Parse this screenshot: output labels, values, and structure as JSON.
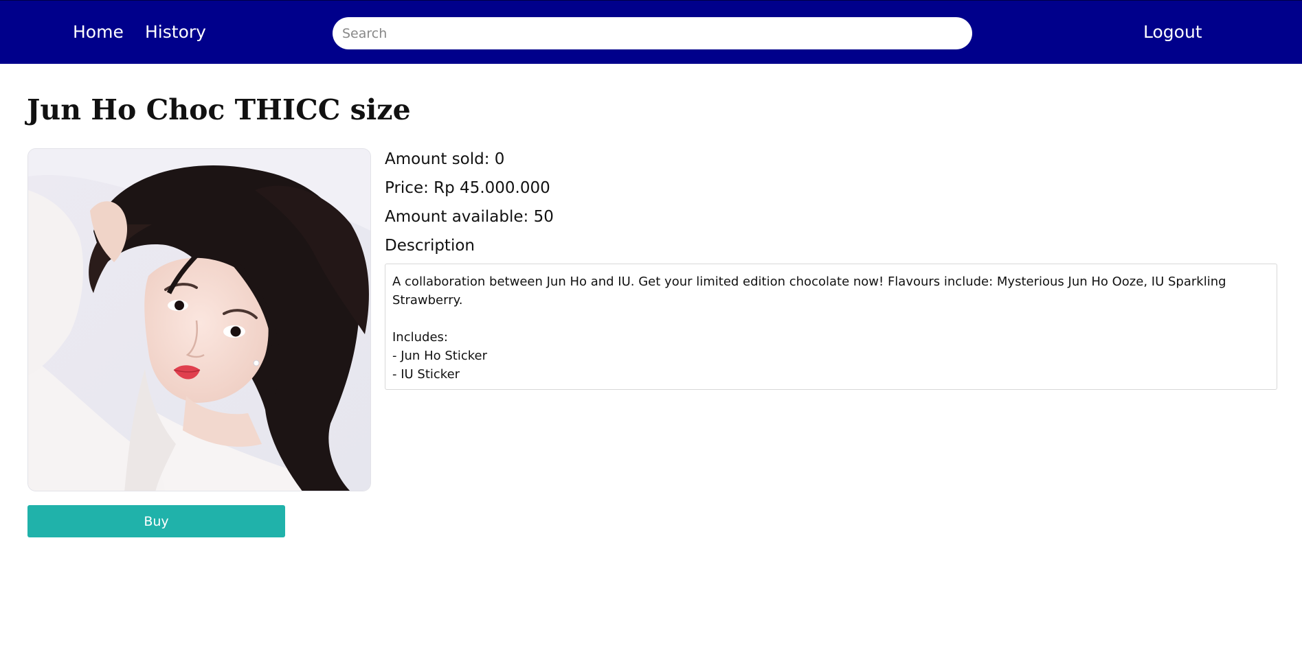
{
  "nav": {
    "home_label": "Home",
    "history_label": "History",
    "logout_label": "Logout",
    "search_placeholder": "Search",
    "search_value": "",
    "background_color": "#00008b"
  },
  "product": {
    "title": "Jun Ho Choc THICC size",
    "image_alt": "Product photo",
    "amount_sold_text": "Amount sold: 0",
    "price_text": "Price: Rp 45.000.000",
    "amount_available_text": "Amount available: 50",
    "description_label": "Description",
    "description": "A collaboration between Jun Ho and IU. Get your limited edition chocolate now! Flavours include: Mysterious Jun Ho Ooze, IU Sparkling Strawberry.\n\nIncludes:\n- Jun Ho Sticker\n- IU Sticker",
    "buy_label": "Buy",
    "buy_color": "#20b2aa"
  }
}
